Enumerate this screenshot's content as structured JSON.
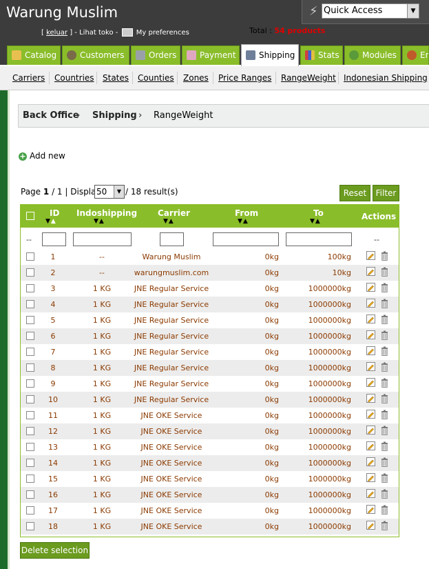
{
  "header": {
    "shop_name": "Warung Muslim",
    "logout": "keluar",
    "view_shop": "Lihat toko",
    "preferences": "My preferences",
    "total_label": "Total :",
    "total_count": "54 products",
    "quick_access": "Quick Access"
  },
  "tabs": [
    {
      "label": "Catalog",
      "icon": "catalog-icon"
    },
    {
      "label": "Customers",
      "icon": "customers-icon"
    },
    {
      "label": "Orders",
      "icon": "orders-icon"
    },
    {
      "label": "Payment",
      "icon": "payment-icon"
    },
    {
      "label": "Shipping",
      "icon": "shipping-icon",
      "active": true
    },
    {
      "label": "Stats",
      "icon": "stats-icon"
    },
    {
      "label": "Modules",
      "icon": "modules-icon"
    },
    {
      "label": "Employees",
      "icon": "employees-icon"
    }
  ],
  "subtabs": [
    "Carriers",
    "Countries",
    "States",
    "Counties",
    "Zones",
    "Price Ranges",
    "RangeWeight",
    "Indonesian Shipping"
  ],
  "breadcrumb": [
    "Back Office",
    "Shipping",
    "RangeWeight"
  ],
  "add_new": "Add new",
  "pagination": {
    "page_label": "Page",
    "page_current": "1",
    "page_total": "/ 1 | Display",
    "display_value": "50",
    "results": "/ 18 result(s)"
  },
  "buttons": {
    "reset": "Reset",
    "filter": "Filter",
    "delete_selection": "Delete selection"
  },
  "table": {
    "headers": [
      "ID",
      "Indoshipping",
      "Carrier",
      "From",
      "To",
      "Actions"
    ],
    "filter_dash": "--",
    "rows": [
      {
        "id": "1",
        "indo": "--",
        "carrier": "Warung Muslim",
        "from": "0kg",
        "to": "100kg"
      },
      {
        "id": "2",
        "indo": "--",
        "carrier": "warungmuslim.com",
        "from": "0kg",
        "to": "10kg"
      },
      {
        "id": "3",
        "indo": "1 KG",
        "carrier": "JNE Regular Service",
        "from": "0kg",
        "to": "1000000kg"
      },
      {
        "id": "4",
        "indo": "1 KG",
        "carrier": "JNE Regular Service",
        "from": "0kg",
        "to": "1000000kg"
      },
      {
        "id": "5",
        "indo": "1 KG",
        "carrier": "JNE Regular Service",
        "from": "0kg",
        "to": "1000000kg"
      },
      {
        "id": "6",
        "indo": "1 KG",
        "carrier": "JNE Regular Service",
        "from": "0kg",
        "to": "1000000kg"
      },
      {
        "id": "7",
        "indo": "1 KG",
        "carrier": "JNE Regular Service",
        "from": "0kg",
        "to": "1000000kg"
      },
      {
        "id": "8",
        "indo": "1 KG",
        "carrier": "JNE Regular Service",
        "from": "0kg",
        "to": "1000000kg"
      },
      {
        "id": "9",
        "indo": "1 KG",
        "carrier": "JNE Regular Service",
        "from": "0kg",
        "to": "1000000kg"
      },
      {
        "id": "10",
        "indo": "1 KG",
        "carrier": "JNE Regular Service",
        "from": "0kg",
        "to": "1000000kg"
      },
      {
        "id": "11",
        "indo": "1 KG",
        "carrier": "JNE OKE Service",
        "from": "0kg",
        "to": "1000000kg"
      },
      {
        "id": "12",
        "indo": "1 KG",
        "carrier": "JNE OKE Service",
        "from": "0kg",
        "to": "1000000kg"
      },
      {
        "id": "13",
        "indo": "1 KG",
        "carrier": "JNE OKE Service",
        "from": "0kg",
        "to": "1000000kg"
      },
      {
        "id": "14",
        "indo": "1 KG",
        "carrier": "JNE OKE Service",
        "from": "0kg",
        "to": "1000000kg"
      },
      {
        "id": "15",
        "indo": "1 KG",
        "carrier": "JNE OKE Service",
        "from": "0kg",
        "to": "1000000kg"
      },
      {
        "id": "16",
        "indo": "1 KG",
        "carrier": "JNE OKE Service",
        "from": "0kg",
        "to": "1000000kg"
      },
      {
        "id": "17",
        "indo": "1 KG",
        "carrier": "JNE OKE Service",
        "from": "0kg",
        "to": "1000000kg"
      },
      {
        "id": "18",
        "indo": "1 KG",
        "carrier": "JNE OKE Service",
        "from": "0kg",
        "to": "1000000kg"
      }
    ]
  },
  "colors": {
    "accent_green": "#8abd2a",
    "button_green": "#6b9b1f",
    "header_dark": "#3c3c3c",
    "sidebar_green": "#1d6b2a",
    "row_text": "#8b3a00",
    "total_red": "#e00000"
  }
}
